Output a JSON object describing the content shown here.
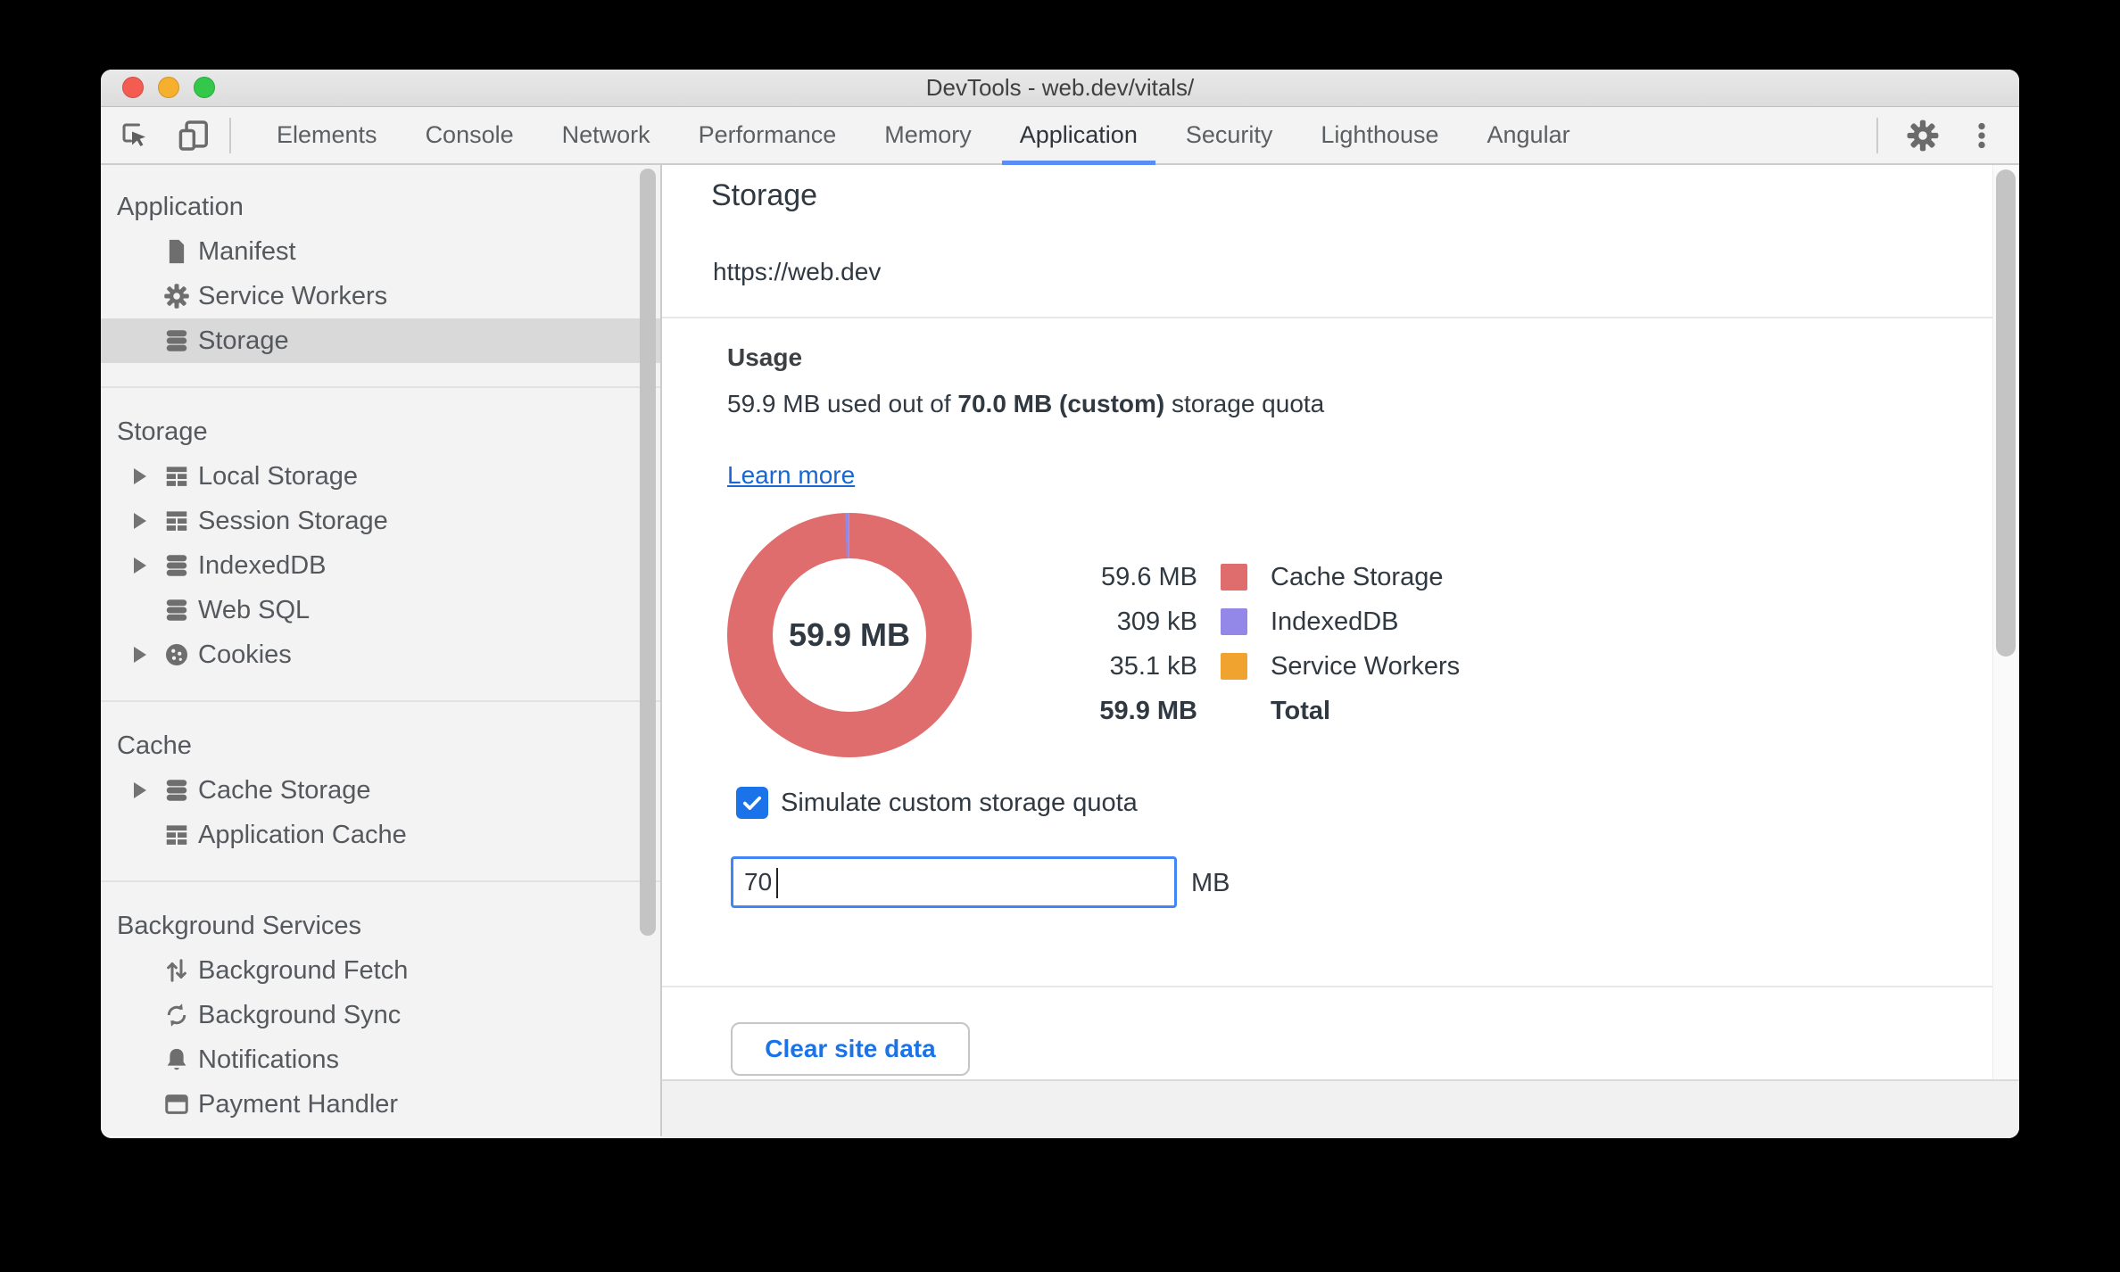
{
  "window": {
    "title": "DevTools - web.dev/vitals/"
  },
  "titlebar_buttons": {
    "close": "close-button",
    "minimize": "minimize-button",
    "zoom": "zoom-button"
  },
  "toolbar": {
    "inspect_icon": "inspect-cursor-icon",
    "device_icon": "device-toolbar-icon",
    "settings_icon": "gear-icon",
    "more_icon": "kebab-menu-icon"
  },
  "tabs": [
    {
      "label": "Elements",
      "active": false
    },
    {
      "label": "Console",
      "active": false
    },
    {
      "label": "Network",
      "active": false
    },
    {
      "label": "Performance",
      "active": false
    },
    {
      "label": "Memory",
      "active": false
    },
    {
      "label": "Application",
      "active": true
    },
    {
      "label": "Security",
      "active": false
    },
    {
      "label": "Lighthouse",
      "active": false
    },
    {
      "label": "Angular",
      "active": false
    }
  ],
  "sidebar": {
    "sections": [
      {
        "header": "Application",
        "items": [
          {
            "label": "Manifest",
            "icon": "document-icon",
            "expander": false,
            "selected": false
          },
          {
            "label": "Service Workers",
            "icon": "gear-icon",
            "expander": false,
            "selected": false
          },
          {
            "label": "Storage",
            "icon": "database-icon",
            "expander": false,
            "selected": true
          }
        ]
      },
      {
        "header": "Storage",
        "items": [
          {
            "label": "Local Storage",
            "icon": "table-icon",
            "expander": true,
            "selected": false
          },
          {
            "label": "Session Storage",
            "icon": "table-icon",
            "expander": true,
            "selected": false
          },
          {
            "label": "IndexedDB",
            "icon": "database-icon",
            "expander": true,
            "selected": false
          },
          {
            "label": "Web SQL",
            "icon": "database-icon",
            "expander": false,
            "selected": false
          },
          {
            "label": "Cookies",
            "icon": "cookie-icon",
            "expander": true,
            "selected": false
          }
        ]
      },
      {
        "header": "Cache",
        "items": [
          {
            "label": "Cache Storage",
            "icon": "database-icon",
            "expander": true,
            "selected": false
          },
          {
            "label": "Application Cache",
            "icon": "table-icon",
            "expander": false,
            "selected": false
          }
        ]
      },
      {
        "header": "Background Services",
        "items": [
          {
            "label": "Background Fetch",
            "icon": "up-down-arrows-icon",
            "expander": false,
            "selected": false
          },
          {
            "label": "Background Sync",
            "icon": "sync-arrows-icon",
            "expander": false,
            "selected": false
          },
          {
            "label": "Notifications",
            "icon": "bell-icon",
            "expander": false,
            "selected": false
          },
          {
            "label": "Payment Handler",
            "icon": "payment-card-icon",
            "expander": false,
            "selected": false
          }
        ]
      }
    ]
  },
  "main": {
    "title": "Storage",
    "origin": "https://web.dev",
    "usage": {
      "heading": "Usage",
      "text_prefix": "59.9 MB used out of ",
      "text_bold": "70.0 MB (custom)",
      "text_suffix": " storage quota",
      "learn_more": "Learn more"
    },
    "legend": {
      "rows": [
        {
          "value": "59.6 MB",
          "label": "Cache Storage",
          "color": "#e06d6d",
          "total": false
        },
        {
          "value": "309 kB",
          "label": "IndexedDB",
          "color": "#9388e8",
          "total": false
        },
        {
          "value": "35.1 kB",
          "label": "Service Workers",
          "color": "#f0a32f",
          "total": false
        },
        {
          "value": "59.9 MB",
          "label": "Total",
          "color": "",
          "total": true
        }
      ]
    },
    "quota": {
      "checkbox_label": "Simulate custom storage quota",
      "checkbox_checked": true,
      "value": "70",
      "unit": "MB"
    },
    "clear_button": "Clear site data"
  },
  "colors": {
    "accent_blue": "#1a73e8",
    "tab_underline": "#5b8df5",
    "link_blue": "#1867d2",
    "input_focus_border": "#4285f4",
    "selected_row_bg": "#d9d9d9"
  },
  "chart_data": {
    "type": "pie",
    "title": "Usage",
    "center_label": "59.9 MB",
    "labels": [
      "Cache Storage",
      "IndexedDB",
      "Service Workers"
    ],
    "values_kb": [
      59600,
      309,
      35.1
    ],
    "display_values": [
      "59.6 MB",
      "309 kB",
      "35.1 kB"
    ],
    "total_display": "59.9 MB",
    "colors": [
      "#e06d6d",
      "#9388e8",
      "#f0a32f"
    ],
    "legend_position": "right",
    "donut_inner_ratio": 0.63
  }
}
